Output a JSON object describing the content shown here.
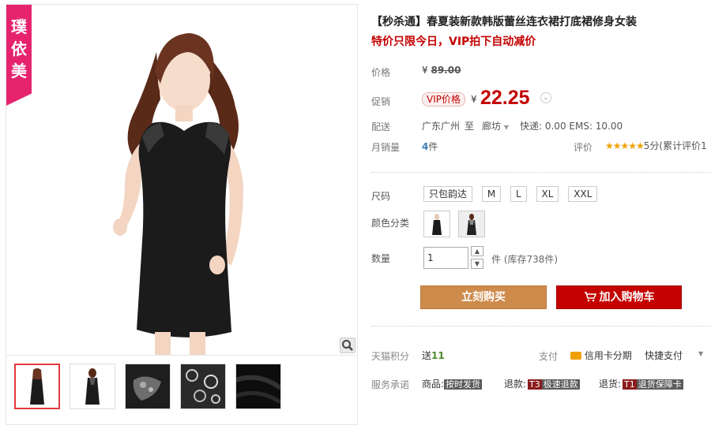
{
  "brand_tag": "璞依美",
  "product": {
    "title": "【秒杀通】春夏装新款韩版蕾丝连衣裙打底裙修身女装",
    "subtitle": "特价只限今日，VIP拍下自动减价"
  },
  "price": {
    "label": "价格",
    "currency": "¥",
    "original": "89.00",
    "promo_label": "促销",
    "vip_tag": "VIP价格",
    "promo_price": "22.25"
  },
  "shipping": {
    "label": "配送",
    "from": "广东广州",
    "to_word": "至",
    "destination": "廊坊",
    "fees": "快递: 0.00 EMS: 10.00"
  },
  "sales": {
    "label": "月销量",
    "count": "4",
    "unit": "件",
    "rating_label": "评价",
    "stars": "★★★★★",
    "rating_text": "5分(累计评价1"
  },
  "size": {
    "label": "尺码",
    "options": [
      "只包韵达",
      "M",
      "L",
      "XL",
      "XXL"
    ]
  },
  "color": {
    "label": "颜色分类"
  },
  "quantity": {
    "label": "数量",
    "value": "1",
    "stock_text": "件 (库存738件)",
    "up": "▲",
    "down": "▼"
  },
  "buttons": {
    "buy_now": "立刻购买",
    "add_cart": "加入购物车"
  },
  "points": {
    "label": "天猫积分",
    "send": "送",
    "value": "11",
    "pay_label": "支付",
    "credit": "信用卡分期",
    "quick_pay": "快捷支付"
  },
  "service": {
    "label": "服务承诺",
    "goods": "商品:",
    "goods_badge": "按时发货",
    "refund": "退款:",
    "refund_code": "T3",
    "refund_badge": "极速退款",
    "returns": "退货:",
    "returns_code": "T1",
    "returns_badge": "退货保障卡"
  },
  "colors": {
    "accent_red": "#c40000",
    "brand_pink": "#e6246e",
    "buy_orange": "#ce8b4c"
  }
}
